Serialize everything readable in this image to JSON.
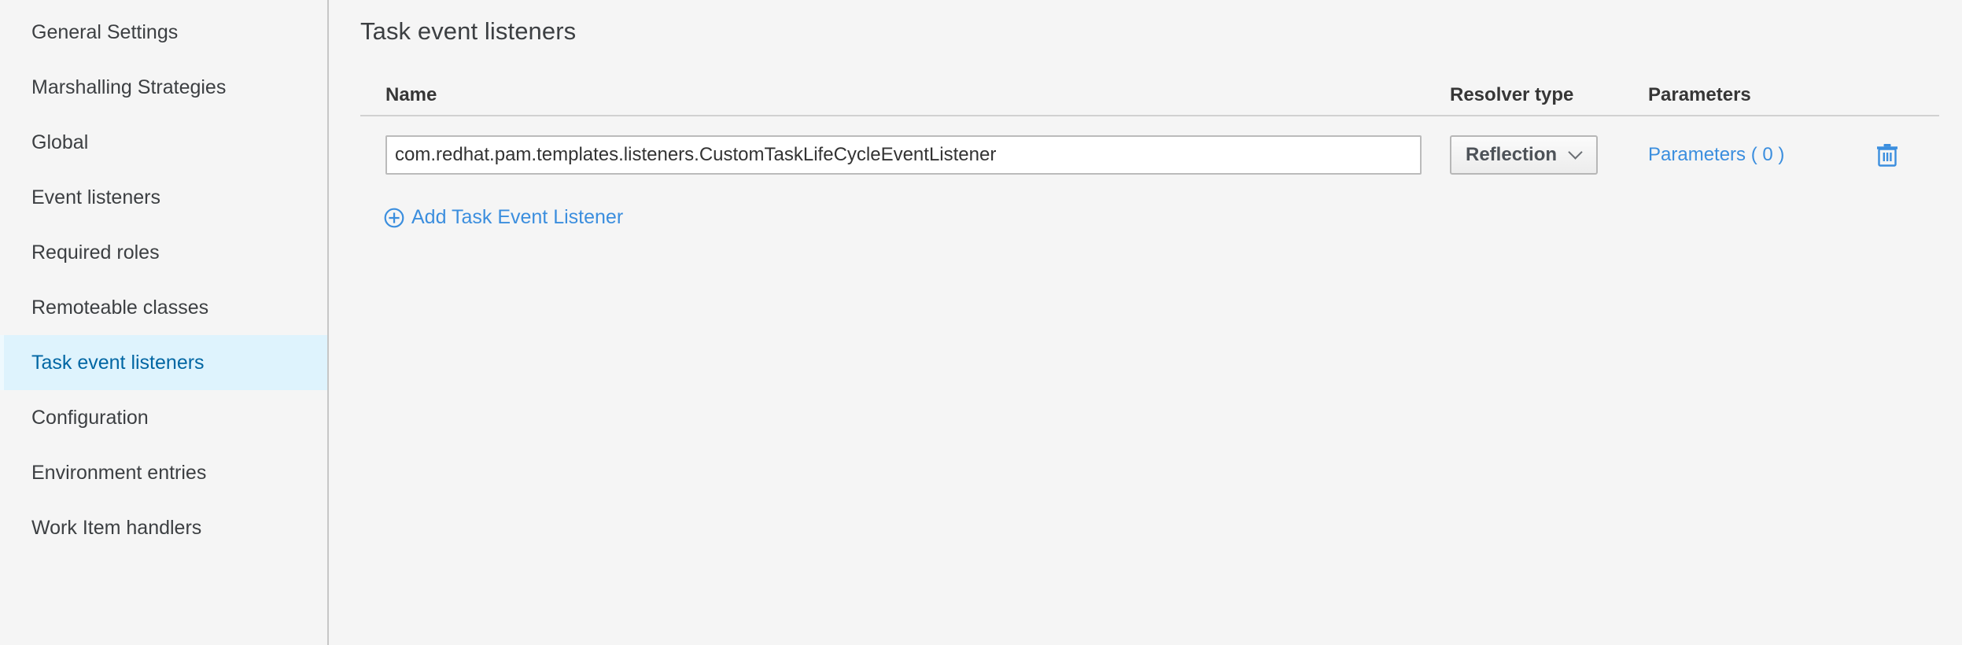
{
  "sidebar": {
    "items": [
      {
        "label": "General Settings",
        "active": false
      },
      {
        "label": "Marshalling Strategies",
        "active": false
      },
      {
        "label": "Global",
        "active": false
      },
      {
        "label": "Event listeners",
        "active": false
      },
      {
        "label": "Required roles",
        "active": false
      },
      {
        "label": "Remoteable classes",
        "active": false
      },
      {
        "label": "Task event listeners",
        "active": true
      },
      {
        "label": "Configuration",
        "active": false
      },
      {
        "label": "Environment entries",
        "active": false
      },
      {
        "label": "Work Item handlers",
        "active": false
      }
    ]
  },
  "main": {
    "page_title": "Task event listeners",
    "table": {
      "headers": {
        "name": "Name",
        "resolver_type": "Resolver type",
        "parameters": "Parameters"
      },
      "rows": [
        {
          "name_value": "com.redhat.pam.templates.listeners.CustomTaskLifeCycleEventListener",
          "name_placeholder": "",
          "resolver_type": "Reflection",
          "parameters_label": "Parameters ( 0 )",
          "delete_icon": "trash-icon"
        }
      ]
    },
    "add_link": {
      "label": "Add Task Event Listener",
      "icon": "plus-circle-icon"
    }
  },
  "colors": {
    "page_background": "#f5f5f5",
    "sidebar_active_background": "#def3fd",
    "sidebar_active_text": "#0066a3",
    "link_blue": "#3b8ede",
    "divider": "#c6c6c6",
    "text": "#3c3f42"
  }
}
